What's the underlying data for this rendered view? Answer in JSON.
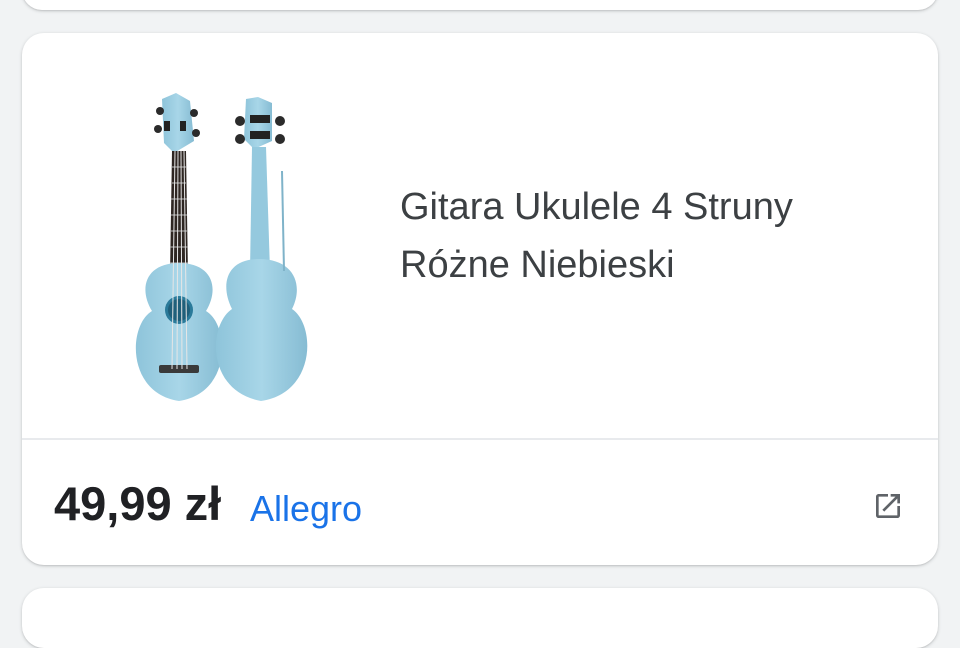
{
  "product": {
    "title_line1": "Gitara Ukulele 4 Struny",
    "title_line2": "Różne Niebieski",
    "image_icon": "ukulele-icon",
    "body_color": "#9ccfe3"
  },
  "offer": {
    "price": "49,99 zł",
    "merchant": "Allegro",
    "link_icon": "open-in-new-icon",
    "link_color": "#1a73e8"
  }
}
